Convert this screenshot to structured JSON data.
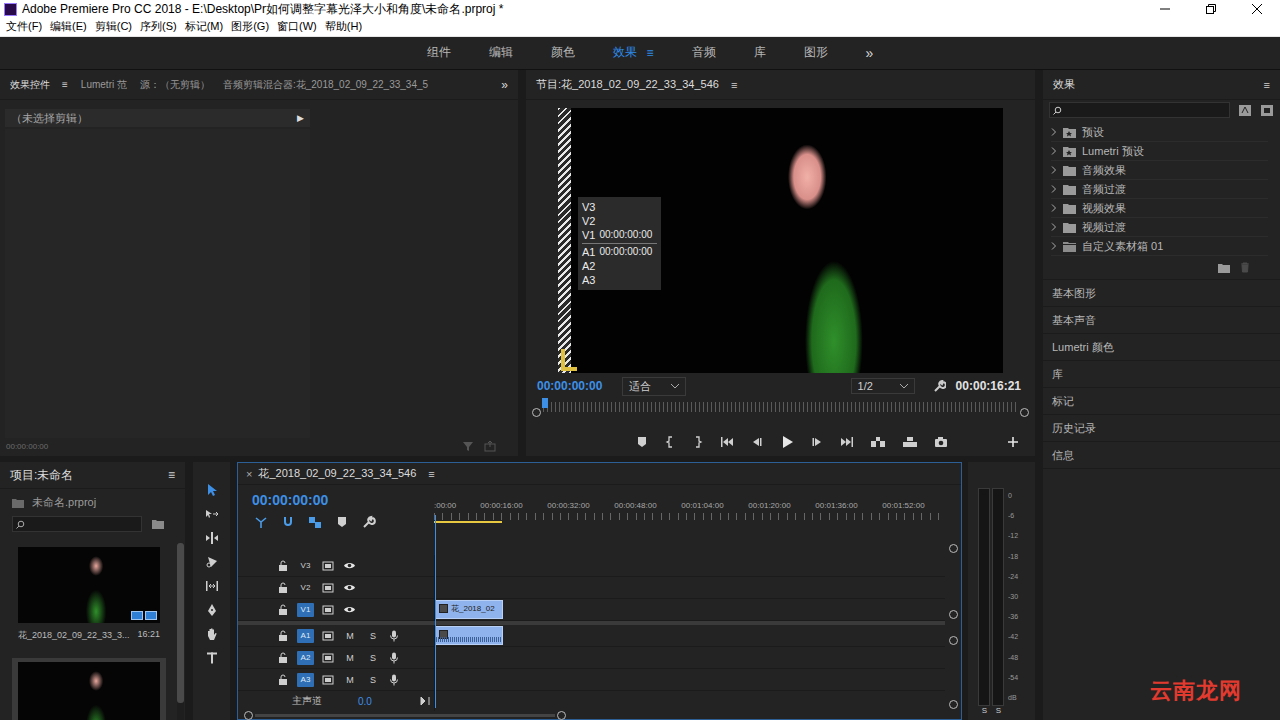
{
  "window": {
    "title": "Adobe Premiere Pro CC 2018 - E:\\Desktop\\Pr如何调整字幕光泽大小和角度\\未命名.prproj *"
  },
  "menu": [
    "文件(F)",
    "编辑(E)",
    "剪辑(C)",
    "序列(S)",
    "标记(M)",
    "图形(G)",
    "窗口(W)",
    "帮助(H)"
  ],
  "workspaces": {
    "items": [
      {
        "label": "组件",
        "selected": false
      },
      {
        "label": "编辑",
        "selected": false
      },
      {
        "label": "颜色",
        "selected": false
      },
      {
        "label": "效果",
        "selected": true
      },
      {
        "label": "音频",
        "selected": false
      },
      {
        "label": "库",
        "selected": false
      },
      {
        "label": "图形",
        "selected": false
      }
    ],
    "menu": "≡",
    "overflow": "»"
  },
  "source_panel": {
    "tabs": [
      {
        "label": "效果控件",
        "selected": true
      },
      {
        "label": "Lumetri 范",
        "selected": false
      },
      {
        "label": "源：（无剪辑）",
        "selected": false
      },
      {
        "label": "音频剪辑混合器:花_2018_02_09_22_33_34_5",
        "selected": false
      }
    ],
    "menu": "≡",
    "overflow": "»",
    "empty_clip": "（未选择剪辑）",
    "expand": "▶",
    "timecode": "00:00:00:00"
  },
  "program": {
    "title": "节目:花_2018_02_09_22_33_34_546",
    "menu": "≡",
    "overlay": [
      {
        "track": "V3",
        "time": "",
        "kind": "video"
      },
      {
        "track": "V2",
        "time": "",
        "kind": "video"
      },
      {
        "track": "V1",
        "time": "00:00:00:00",
        "kind": "video"
      },
      {
        "track": "A1",
        "time": "00:00:00:00",
        "kind": "audio"
      },
      {
        "track": "A2",
        "time": "",
        "kind": "audio"
      },
      {
        "track": "A3",
        "time": "",
        "kind": "audio"
      }
    ],
    "timecode": "00:00:00:00",
    "zoom": "适合",
    "resolution": "1/2",
    "duration": "00:00:16:21",
    "playhead": 0
  },
  "effects": {
    "title": "效果",
    "menu": "≡",
    "search": {
      "placeholder": ""
    },
    "tree": [
      {
        "label": "预设",
        "expanded": false,
        "kind": "preset"
      },
      {
        "label": "Lumetri 预设",
        "expanded": false,
        "kind": "preset"
      },
      {
        "label": "音频效果",
        "expanded": false,
        "kind": "folder"
      },
      {
        "label": "音频过渡",
        "expanded": false,
        "kind": "folder"
      },
      {
        "label": "视频效果",
        "expanded": false,
        "kind": "folder"
      },
      {
        "label": "视频过渡",
        "expanded": false,
        "kind": "folder"
      },
      {
        "label": "自定义素材箱 01",
        "expanded": false,
        "kind": "bin"
      }
    ],
    "sections": [
      "基本图形",
      "基本声音",
      "Lumetri 颜色",
      "库",
      "标记",
      "历史记录",
      "信息"
    ]
  },
  "project": {
    "title": "项目:未命名",
    "menu": "≡",
    "file": "未命名.prproj",
    "search": {
      "placeholder": ""
    },
    "items": [
      {
        "name": "花_2018_02_09_22_33_3...",
        "duration": "16:21",
        "selected": false
      },
      {
        "selected": true
      }
    ]
  },
  "tools": [
    {
      "kind": "selection",
      "selected": true
    },
    {
      "kind": "track-select",
      "selected": false
    },
    {
      "kind": "ripple",
      "selected": false
    },
    {
      "kind": "razor",
      "selected": false
    },
    {
      "kind": "slip",
      "selected": false
    },
    {
      "kind": "pen",
      "selected": false
    },
    {
      "kind": "hand",
      "selected": false
    },
    {
      "kind": "type",
      "selected": false
    }
  ],
  "timeline": {
    "close": "×",
    "title": "花_2018_02_09_22_33_34_546",
    "menu": "≡",
    "timecode": "00:00:00:00",
    "ruler": [
      ":00:00",
      "00:00:16:00",
      "00:00:32:00",
      "00:00:48:00",
      "00:01:04:00",
      "00:01:20:00",
      "00:01:36:00",
      "00:01:52:00"
    ],
    "mute": "M",
    "solo": "S",
    "playhead": 0,
    "tracks": [
      {
        "name": "V3",
        "kind": "video",
        "targeted": false,
        "has_clip": false,
        "clip_label": ""
      },
      {
        "name": "V2",
        "kind": "video",
        "targeted": false,
        "has_clip": false,
        "clip_label": ""
      },
      {
        "name": "V1",
        "kind": "video",
        "targeted": true,
        "has_clip": true,
        "clip_label": "花_2018_02"
      },
      {
        "name": "A1",
        "kind": "audio",
        "targeted": true,
        "has_clip": true,
        "clip_label": ""
      },
      {
        "name": "A2",
        "kind": "audio",
        "targeted": true,
        "has_clip": false,
        "clip_label": ""
      },
      {
        "name": "A3",
        "kind": "audio",
        "targeted": true,
        "has_clip": false,
        "clip_label": ""
      }
    ],
    "master": {
      "label": "主声道",
      "value": "0.0"
    }
  },
  "meter": {
    "scale": [
      "0",
      "-6",
      "-12",
      "-18",
      "-24",
      "-30",
      "-36",
      "-42",
      "-48",
      "-54",
      "dB"
    ],
    "channels": [
      {
        "solo": "S",
        "level": 0
      },
      {
        "solo": "S",
        "level": 0
      }
    ]
  },
  "watermark": "云南龙网"
}
